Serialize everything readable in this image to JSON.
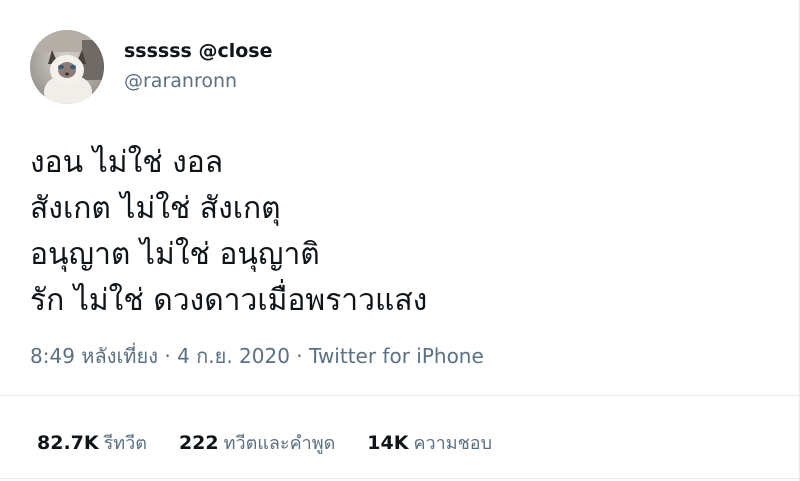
{
  "user": {
    "display_name": "ssssss @close",
    "handle": "@raranronn",
    "avatar_icon": "cat-avatar"
  },
  "tweet": {
    "lines": [
      "งอน ไม่ใช่ งอล",
      "สังเกต ไม่ใช่ สังเกตุ",
      "อนุญาต ไม่ใช่ อนุญาติ",
      "รัก ไม่ใช่ ดวงดาวเมื่อพราวแสง"
    ]
  },
  "meta": {
    "time": "8:49 หลังเที่ยง",
    "separator1": " · ",
    "date": "4 ก.ย. 2020",
    "separator2": " · ",
    "source": "Twitter for iPhone"
  },
  "stats": {
    "retweets_count": "82.7K",
    "retweets_label": "รีทวีต",
    "quotes_count": "222",
    "quotes_label": "ทวีตและคำพูด",
    "likes_count": "14K",
    "likes_label": "ความชอบ"
  },
  "colors": {
    "text": "#0f1419",
    "secondary": "#5b7083",
    "divider": "#e6ecf0"
  }
}
